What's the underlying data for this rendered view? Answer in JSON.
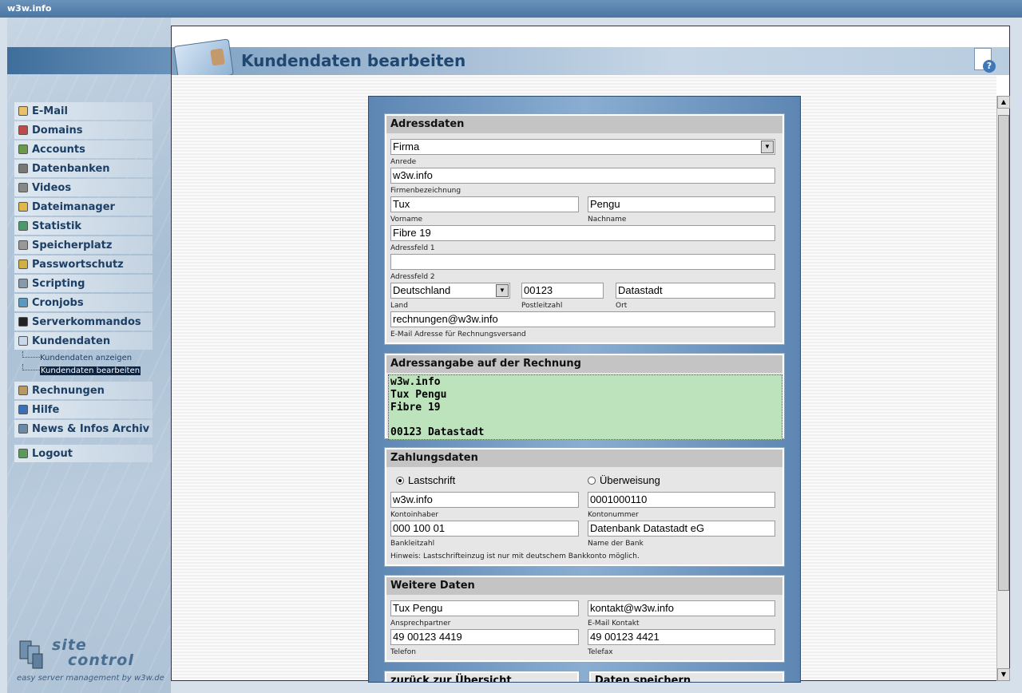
{
  "window": {
    "title": "w3w.info"
  },
  "nav": {
    "items": [
      {
        "label": "E-Mail",
        "icon": "letter-icon"
      },
      {
        "label": "Domains",
        "icon": "domains-icon"
      },
      {
        "label": "Accounts",
        "icon": "users-icon"
      },
      {
        "label": "Datenbanken",
        "icon": "database-icon"
      },
      {
        "label": "Videos",
        "icon": "film-icon"
      },
      {
        "label": "Dateimanager",
        "icon": "folder-icon"
      },
      {
        "label": "Statistik",
        "icon": "bar-chart-icon"
      },
      {
        "label": "Speicherplatz",
        "icon": "disk-icon"
      },
      {
        "label": "Passwortschutz",
        "icon": "lock-icon"
      },
      {
        "label": "Scripting",
        "icon": "script-icon"
      },
      {
        "label": "Cronjobs",
        "icon": "clock-icon"
      },
      {
        "label": "Serverkommandos",
        "icon": "terminal-icon"
      },
      {
        "label": "Kundendaten",
        "icon": "id-card-icon"
      }
    ],
    "sub_items": [
      {
        "label": "Kundendaten anzeigen"
      },
      {
        "label": "Kundendaten bearbeiten"
      }
    ],
    "items_after": [
      {
        "label": "Rechnungen",
        "icon": "invoice-icon"
      },
      {
        "label": "Hilfe",
        "icon": "help-icon"
      },
      {
        "label": "News & Infos Archiv",
        "icon": "info-icon"
      }
    ],
    "logout": {
      "label": "Logout",
      "icon": "logout-icon"
    }
  },
  "logo": {
    "line1": "site",
    "line2": "control",
    "tagline": "easy server management by w3w.de"
  },
  "header": {
    "title": "Kundendaten bearbeiten"
  },
  "colors": {
    "accent": "#1f4770",
    "addr_preview_bg": "#bde3bd"
  },
  "form": {
    "adressdaten": {
      "title": "Adressdaten",
      "type_select": "Firma",
      "anrede_value": "w3w.info",
      "anrede_label": "Anrede",
      "vorname_value": "Tux",
      "nachname_value": "Pengu",
      "firmen_label": "Firmenbezeichnung",
      "vorname_label": "Vorname",
      "nachname_label": "Nachname",
      "adressfeld1_value": "Fibre 19",
      "adressfeld1_label": "Adressfeld 1",
      "adressfeld2_value": "",
      "adressfeld2_label": "Adressfeld 2",
      "land_value": "Deutschland",
      "plz_value": "00123",
      "ort_value": "Datastadt",
      "land_label": "Land",
      "plz_label": "Postleitzahl",
      "ort_label": "Ort",
      "email_value": "rechnungen@w3w.info",
      "email_label": "E-Mail Adresse für Rechnungsversand"
    },
    "rechnung": {
      "title": "Adressangabe auf der Rechnung",
      "lines": [
        "w3w.info",
        "Tux Pengu",
        "Fibre 19",
        "",
        "00123 Datastadt"
      ]
    },
    "zahlung": {
      "title": "Zahlungsdaten",
      "radio_lastschrift": "Lastschrift",
      "radio_ueberweisung": "Überweisung",
      "selected": "Lastschrift",
      "inhaber_value": "w3w.info",
      "inhaber_label": "Kontoinhaber",
      "nummer_value": "0001000110",
      "nummer_label": "Kontonummer",
      "blz_value": "000 100 01",
      "blz_label": "Bankleitzahl",
      "bank_value": "Datenbank Datastadt eG",
      "bank_label": "Name der Bank",
      "hint": "Hinweis: Lastschrifteinzug ist nur mit deutschem Bankkonto möglich."
    },
    "weitere": {
      "title": "Weitere Daten",
      "ansprech_value": "Tux Pengu",
      "ansprech_label": "Ansprechpartner",
      "email_value": "kontakt@w3w.info",
      "email_label": "E-Mail Kontakt",
      "telefon_value": " 49 00123 4419",
      "telefon_label": "Telefon",
      "telefax_value": "49 00123 4421",
      "telefax_label": "Telefax"
    },
    "buttons": {
      "back": "zurück zur Übersicht",
      "save": "Daten speichern"
    }
  }
}
